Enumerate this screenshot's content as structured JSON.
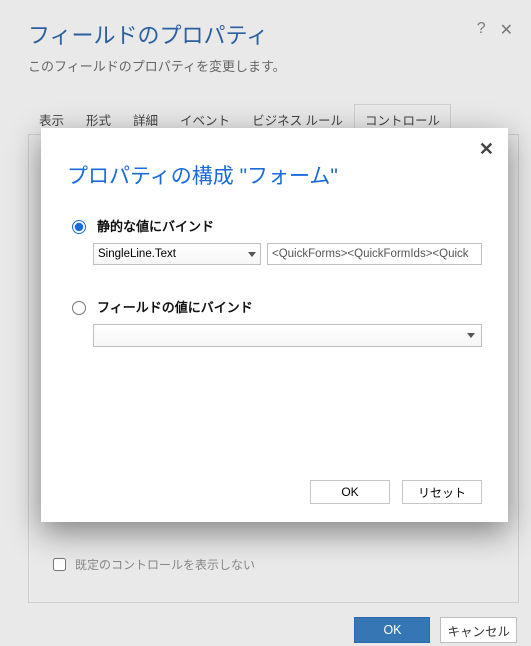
{
  "page": {
    "title": "フィールドのプロパティ",
    "subtitle": "このフィールドのプロパティを変更します。"
  },
  "tabs": {
    "items": [
      {
        "label": "表示"
      },
      {
        "label": "形式"
      },
      {
        "label": "詳細"
      },
      {
        "label": "イベント"
      },
      {
        "label": "ビジネス ルール"
      },
      {
        "label": "コントロール"
      }
    ]
  },
  "controls_tab": {
    "hide_default_control_label": "既定のコントロールを表示しない"
  },
  "footer": {
    "ok_label": "OK",
    "cancel_label": "キャンセル"
  },
  "modal": {
    "title": "プロパティの構成 \"フォーム\"",
    "static_label": "静的な値にバインド",
    "field_label": "フィールドの値にバインド",
    "type_selected": "SingleLine.Text",
    "static_value": "<QuickForms><QuickFormIds><Quick",
    "ok_label": "OK",
    "reset_label": "リセット"
  }
}
